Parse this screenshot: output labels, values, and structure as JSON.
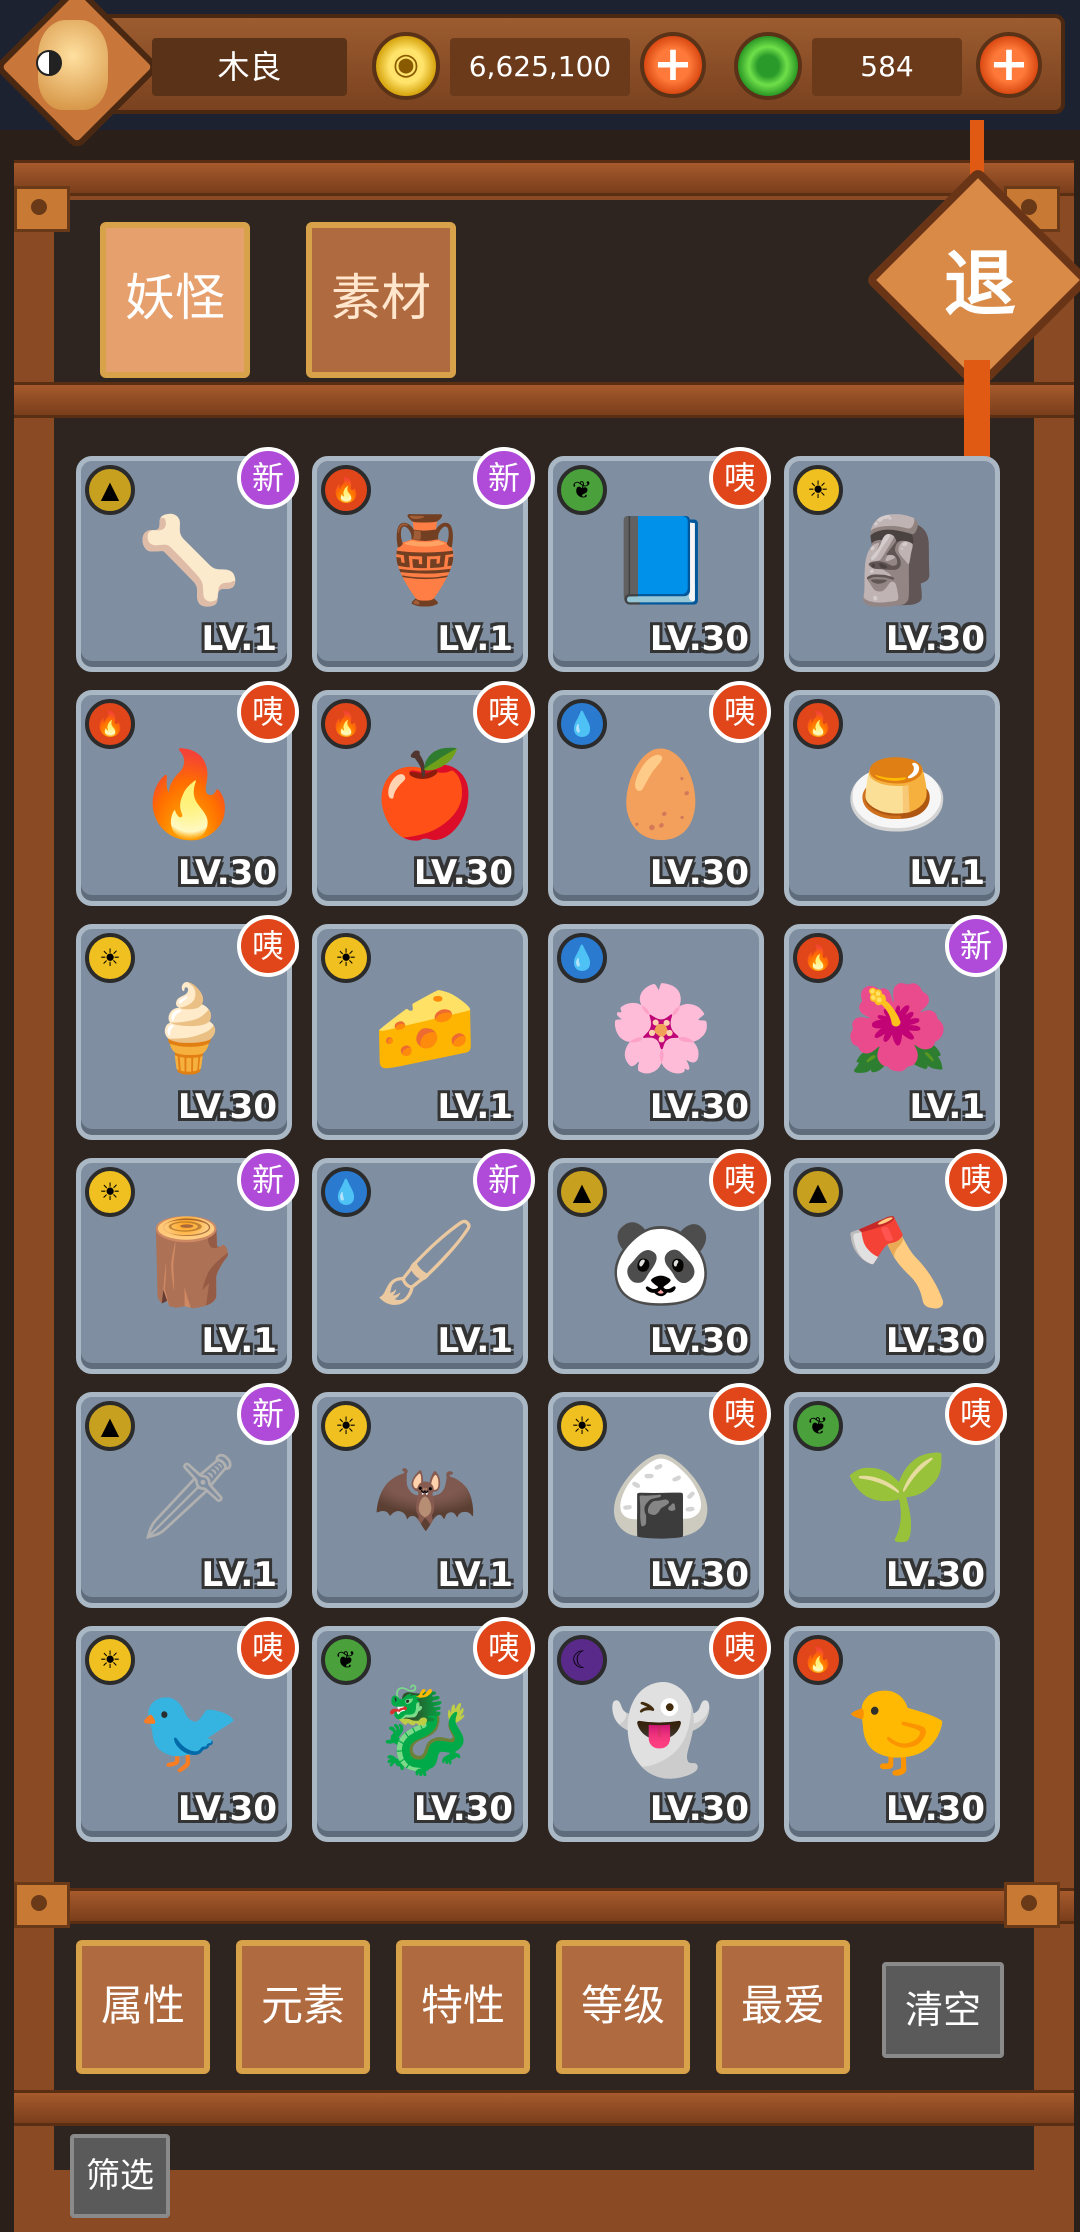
{
  "player": {
    "name": "木良"
  },
  "currency": {
    "coins": "6,625,100",
    "gems": "584",
    "plus_symbol": "+"
  },
  "tabs": [
    {
      "label": "妖怪",
      "active": true
    },
    {
      "label": "素材",
      "active": false
    }
  ],
  "exit_label": "退",
  "badges": {
    "new": "新",
    "hot": "咦"
  },
  "cards": [
    {
      "element": "earth",
      "level": "LV.1",
      "badge": "new"
    },
    {
      "element": "fire",
      "level": "LV.1",
      "badge": "new"
    },
    {
      "element": "wood",
      "level": "LV.30",
      "badge": "hot"
    },
    {
      "element": "light",
      "level": "LV.30",
      "badge": ""
    },
    {
      "element": "fire",
      "level": "LV.30",
      "badge": "hot"
    },
    {
      "element": "fire",
      "level": "LV.30",
      "badge": "hot"
    },
    {
      "element": "water",
      "level": "LV.30",
      "badge": "hot"
    },
    {
      "element": "fire",
      "level": "LV.1",
      "badge": ""
    },
    {
      "element": "light",
      "level": "LV.30",
      "badge": "hot"
    },
    {
      "element": "light",
      "level": "LV.1",
      "badge": ""
    },
    {
      "element": "water",
      "level": "LV.30",
      "badge": ""
    },
    {
      "element": "fire",
      "level": "LV.1",
      "badge": "new"
    },
    {
      "element": "light",
      "level": "LV.1",
      "badge": "new"
    },
    {
      "element": "water",
      "level": "LV.1",
      "badge": "new"
    },
    {
      "element": "earth",
      "level": "LV.30",
      "badge": "hot"
    },
    {
      "element": "earth",
      "level": "LV.30",
      "badge": "hot"
    },
    {
      "element": "earth",
      "level": "LV.1",
      "badge": "new"
    },
    {
      "element": "light",
      "level": "LV.1",
      "badge": ""
    },
    {
      "element": "light",
      "level": "LV.30",
      "badge": "hot"
    },
    {
      "element": "wood",
      "level": "LV.30",
      "badge": "hot"
    },
    {
      "element": "light",
      "level": "LV.30",
      "badge": "hot"
    },
    {
      "element": "wood",
      "level": "LV.30",
      "badge": "hot"
    },
    {
      "element": "dark",
      "level": "LV.30",
      "badge": "hot"
    },
    {
      "element": "fire",
      "level": "LV.30",
      "badge": ""
    }
  ],
  "filters": [
    "属性",
    "元素",
    "特性",
    "等级",
    "最爱"
  ],
  "clear_label": "清空",
  "screen_label": "筛选"
}
